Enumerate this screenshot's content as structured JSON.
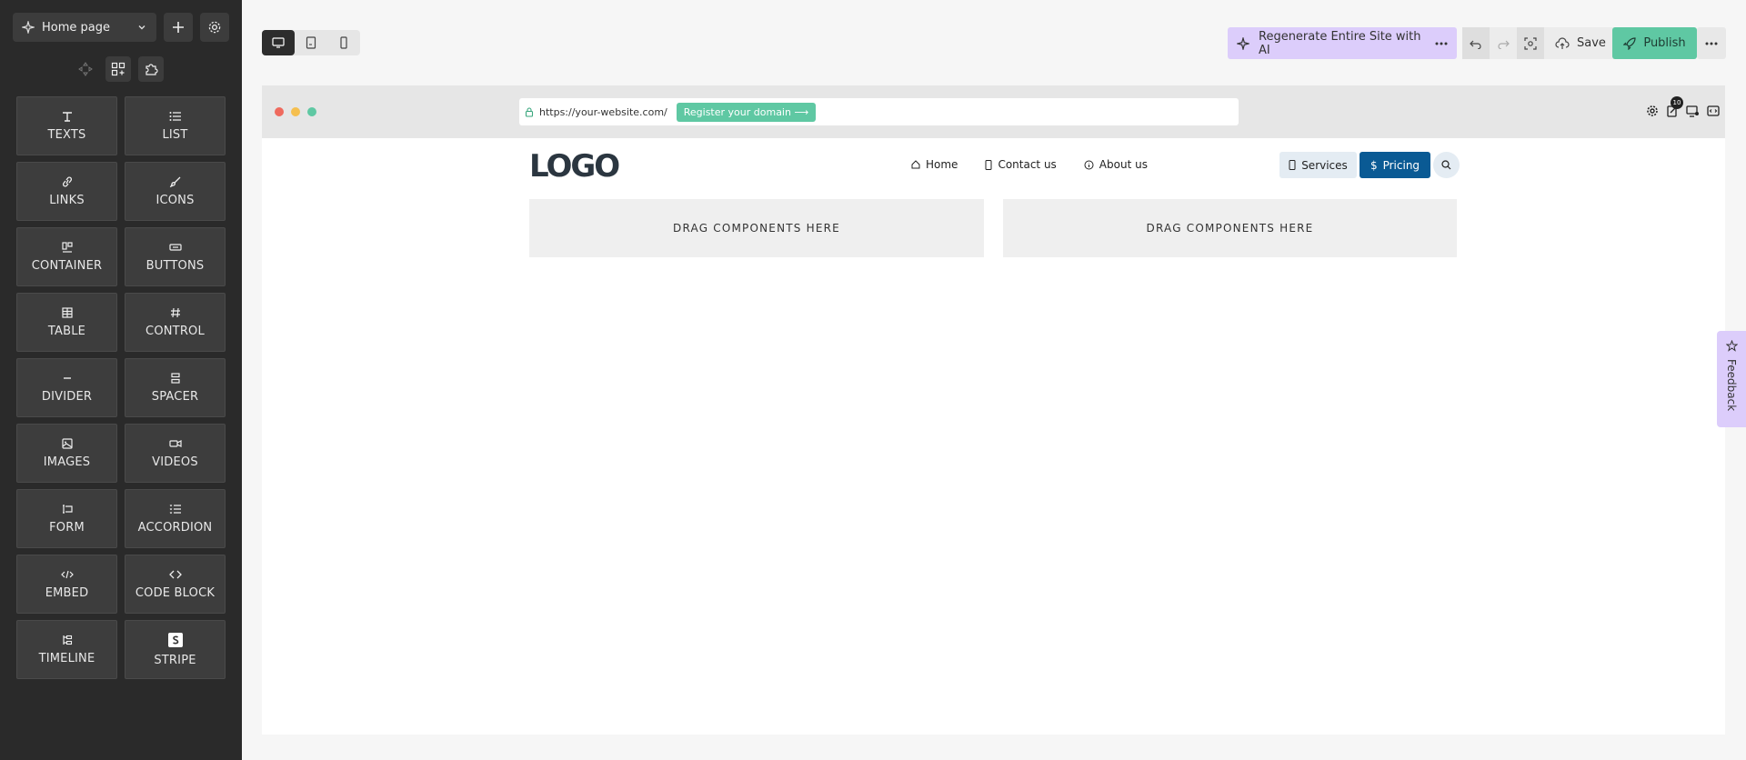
{
  "sidebar": {
    "page_selector": "Home page",
    "components": [
      {
        "label": "TEXTS",
        "icon": "text-icon"
      },
      {
        "label": "LIST",
        "icon": "list-icon"
      },
      {
        "label": "LINKS",
        "icon": "link-icon"
      },
      {
        "label": "ICONS",
        "icon": "brush-icon"
      },
      {
        "label": "CONTAINER",
        "icon": "container-icon"
      },
      {
        "label": "BUTTONS",
        "icon": "button-icon"
      },
      {
        "label": "TABLE",
        "icon": "table-icon"
      },
      {
        "label": "CONTROL",
        "icon": "hash-icon"
      },
      {
        "label": "DIVIDER",
        "icon": "divider-icon"
      },
      {
        "label": "SPACER",
        "icon": "spacer-icon"
      },
      {
        "label": "IMAGES",
        "icon": "image-icon"
      },
      {
        "label": "VIDEOS",
        "icon": "video-icon"
      },
      {
        "label": "FORM",
        "icon": "form-icon"
      },
      {
        "label": "ACCORDION",
        "icon": "accordion-icon"
      },
      {
        "label": "EMBED",
        "icon": "embed-icon"
      },
      {
        "label": "CODE BLOCK",
        "icon": "code-icon"
      },
      {
        "label": "TIMELINE",
        "icon": "timeline-icon"
      },
      {
        "label": "STRIPE",
        "icon": "stripe-icon"
      }
    ]
  },
  "toolbar": {
    "regenerate_label": "Regenerate Entire Site with AI",
    "save_label": "Save",
    "publish_label": "Publish"
  },
  "browser": {
    "url": "https://your-website.com/",
    "register_domain": "Register your domain ⟶",
    "badge_count": "10"
  },
  "site": {
    "logo_text": "LOGO",
    "nav": [
      "Home",
      "Contact us",
      "About us"
    ],
    "services_label": "Services",
    "pricing_label": "Pricing",
    "dropzone_label": "DRAG COMPONENTS HERE"
  },
  "feedback_label": "Feedback",
  "colors": {
    "sidebar_bg": "#2a2a2a",
    "accent_green": "#5fc8a3",
    "accent_purple": "#dccdfb",
    "pricing_blue": "#0a5a94"
  }
}
